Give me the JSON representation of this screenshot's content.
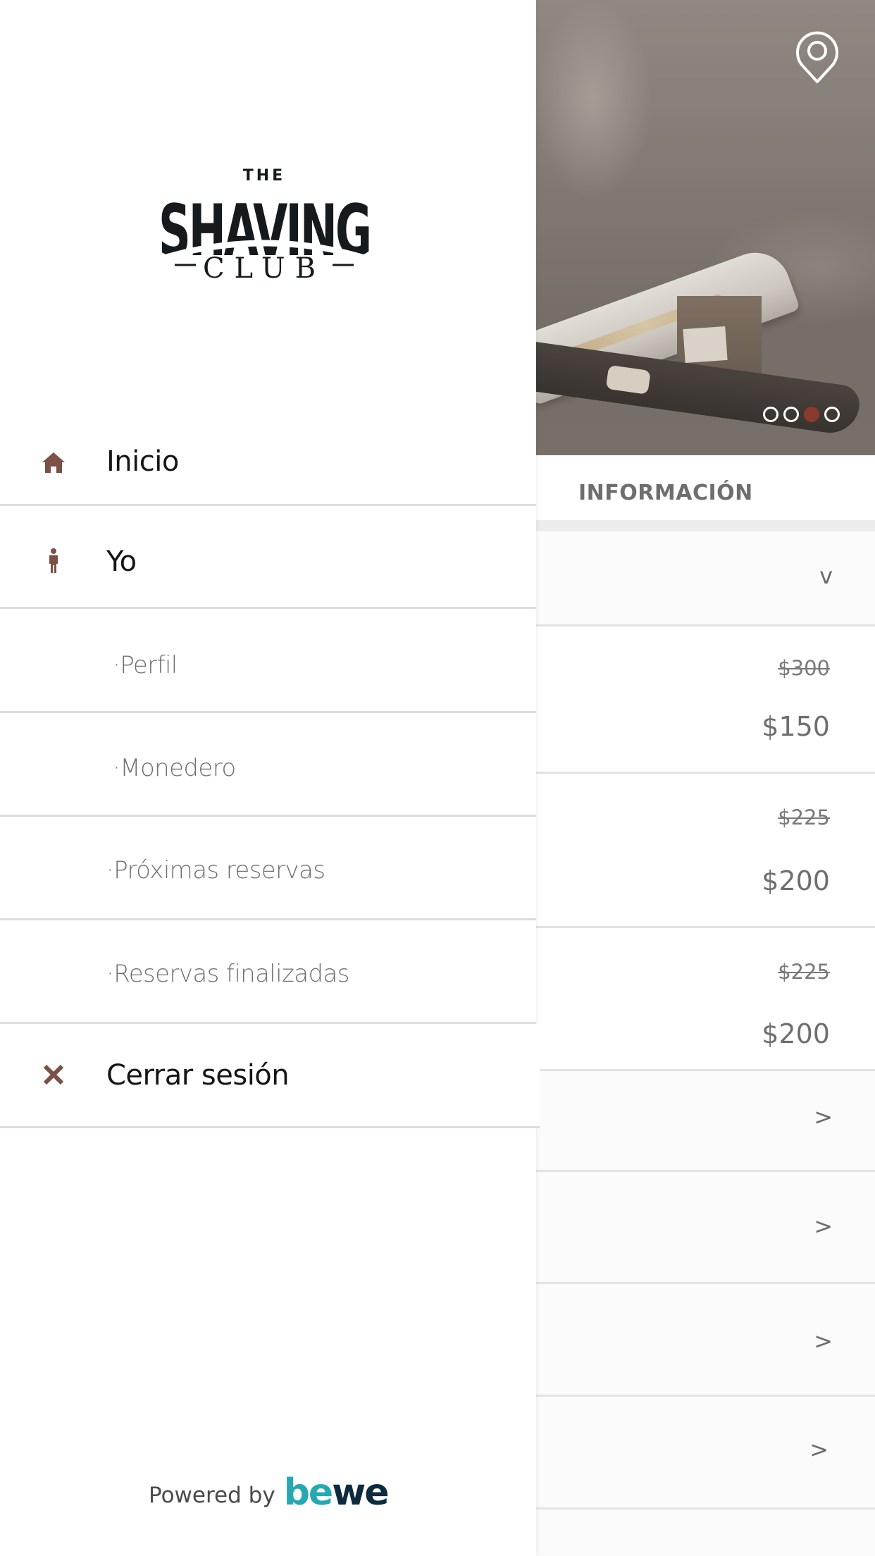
{
  "brand": {
    "logo_line1": "THE",
    "logo_line2": "SHAVING",
    "logo_line3": "CLUB",
    "accent_color": "#7b5045",
    "carousel_active_color": "#8a3a2e"
  },
  "drawer": {
    "items": [
      {
        "label": "Inicio",
        "icon": "home-icon"
      },
      {
        "label": "Yo",
        "icon": "person-icon"
      },
      {
        "label": "·Perfil",
        "icon": null
      },
      {
        "label": "·Monedero",
        "icon": null
      },
      {
        "label": "·Próximas reservas",
        "icon": null
      },
      {
        "label": "·Reservas finalizadas",
        "icon": null
      },
      {
        "label": "Cerrar sesión",
        "icon": "close-icon"
      }
    ],
    "footer": {
      "powered_by": "Powered by",
      "bewe_part1": "be",
      "bewe_part2": "we"
    }
  },
  "background_page": {
    "hero": {
      "location_icon": "map-pin-icon",
      "carousel": {
        "count": 4,
        "active_index": 2
      }
    },
    "section_title": "INFORMACIÓN",
    "expand_row": {
      "icon": "chevron-down",
      "glyph": "v"
    },
    "price_rows": [
      {
        "old_price": "$300",
        "new_price": "$150"
      },
      {
        "old_price": "$225",
        "new_price": "$200"
      },
      {
        "old_price": "$225",
        "new_price": "$200"
      }
    ],
    "nav_rows": [
      {
        "glyph": ">"
      },
      {
        "glyph": ">"
      },
      {
        "glyph": ">"
      },
      {
        "glyph": ">"
      }
    ]
  }
}
